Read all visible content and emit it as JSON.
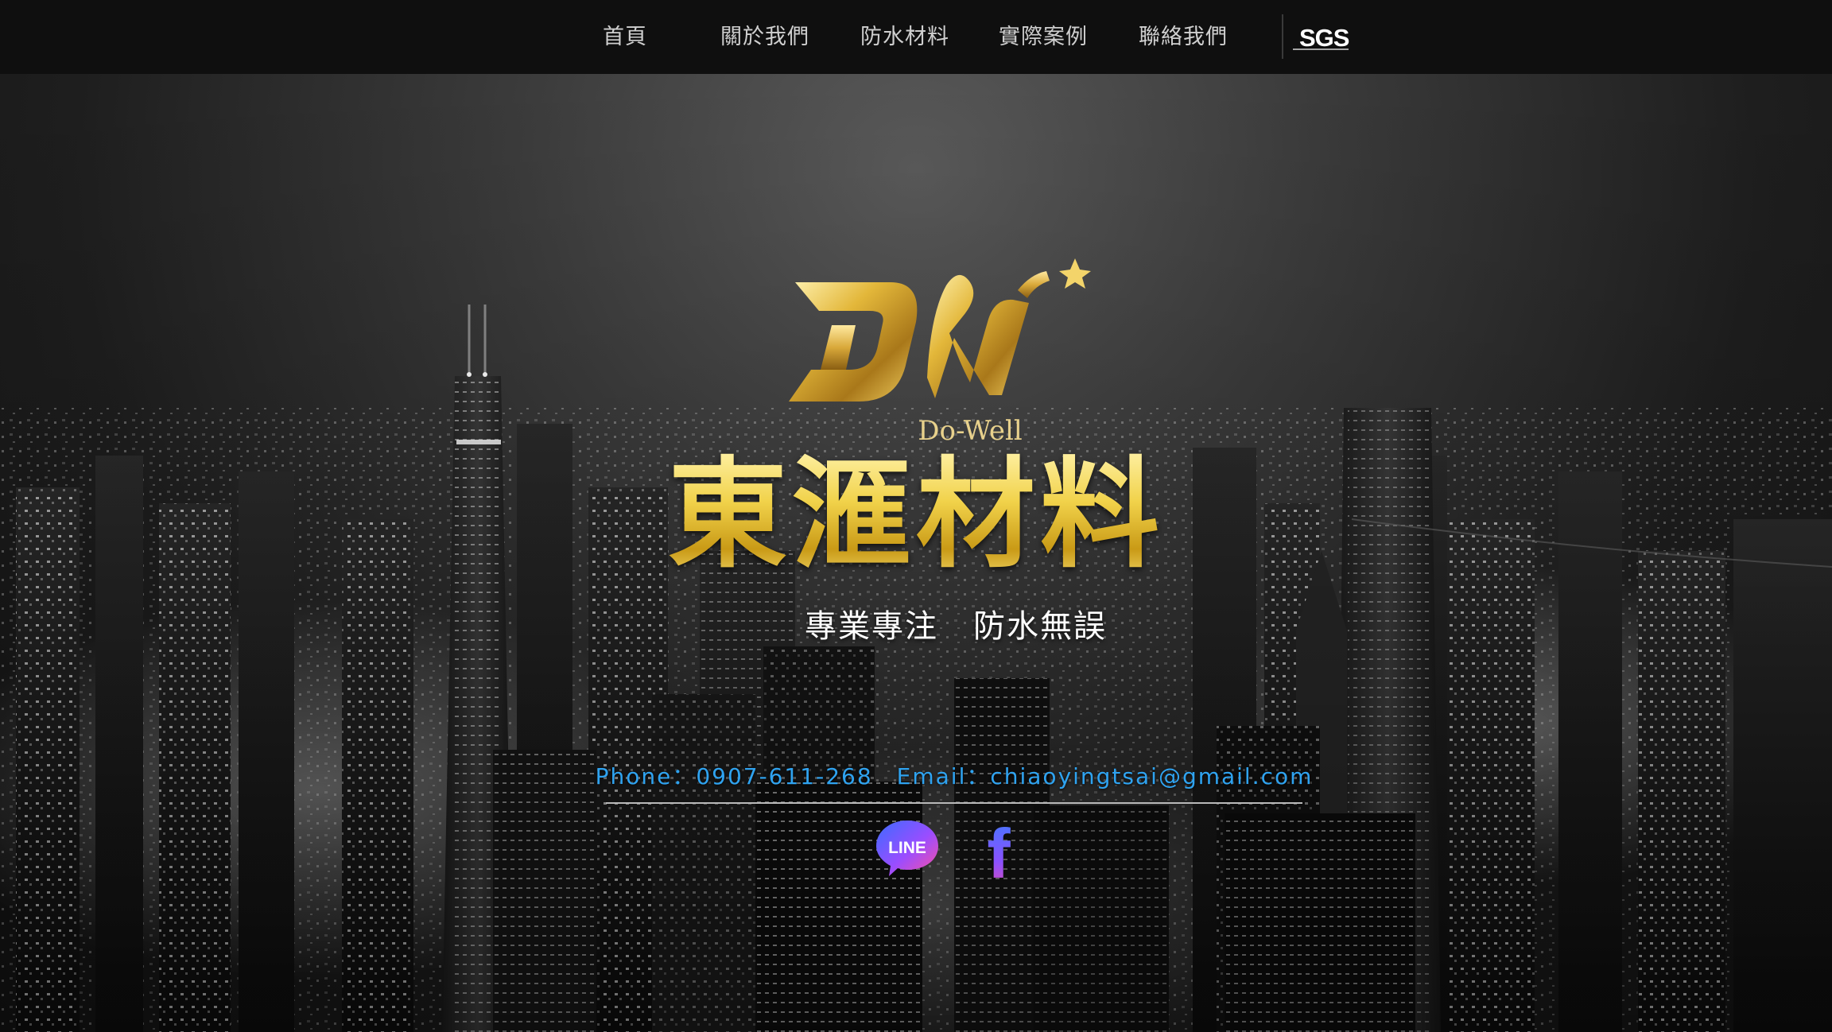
{
  "nav": {
    "items": [
      {
        "label": "首頁"
      },
      {
        "label": "關於我們"
      },
      {
        "label": "防水材料"
      },
      {
        "label": "實際案例"
      },
      {
        "label": "聯絡我們"
      }
    ],
    "sgs_label": "SGS"
  },
  "hero": {
    "logo_text": "Do-Well",
    "brand_name": "東滙材料",
    "slogan": [
      "專業專注",
      "防水無誤"
    ],
    "contact": {
      "phone": "Phone：0907-611-268",
      "email": "Email：chiaoyingtsai@gmail.com"
    },
    "social": {
      "line_label": "LINE",
      "facebook_label": "f"
    }
  },
  "colors": {
    "nav_bg": "#0f0f0f",
    "nav_text": "#cfcfcf",
    "gold": "#e3bf3a",
    "contact_blue": "#2fa3f0"
  }
}
